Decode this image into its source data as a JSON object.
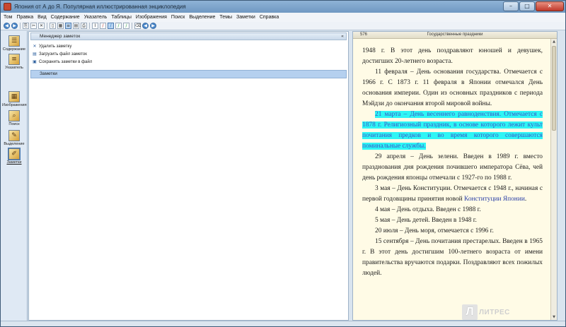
{
  "window": {
    "title": "Япония от А до Я. Популярная иллюстрированная энциклопедия",
    "minimize": "–",
    "maximize": "□",
    "close": "✕"
  },
  "menu": [
    "Том",
    "Правка",
    "Вид",
    "Содержание",
    "Указатель",
    "Таблицы",
    "Изображения",
    "Поиск",
    "Выделение",
    "Темы",
    "Заметки",
    "Справка"
  ],
  "toolbar": {
    "icons": [
      "back-icon",
      "forward-icon",
      "copy-icon",
      "cut-icon",
      "delete-icon",
      "page-icon",
      "grid-icon",
      "list-icon",
      "layout-icon",
      "print-icon",
      "cursor-icon",
      "pen-icon",
      "highlighter-icon",
      "marker-icon",
      "pencil-icon",
      "eraser-icon",
      "search-icon",
      "prev-icon",
      "next-icon"
    ]
  },
  "sidebar": {
    "items": [
      {
        "label": "Содержание",
        "icon": "book-icon",
        "glyph": "☰"
      },
      {
        "label": "Указатель",
        "icon": "index-icon",
        "glyph": "≡"
      },
      {
        "label": "Изображения",
        "icon": "images-icon",
        "glyph": "▦"
      },
      {
        "label": "Поиск",
        "icon": "search-icon",
        "glyph": "⌕"
      },
      {
        "label": "Выделение",
        "icon": "highlight-icon",
        "glyph": "✎"
      },
      {
        "label": "Заметки",
        "icon": "notes-icon",
        "glyph": "✐"
      }
    ]
  },
  "notes": {
    "manager_title": "Менеджер заметок",
    "collapse": "«",
    "actions": [
      {
        "label": "Удалить заметку",
        "icon": "delete-note-icon",
        "glyph": "✕"
      },
      {
        "label": "Загрузить файл заметок",
        "icon": "load-notes-icon",
        "glyph": "▤"
      },
      {
        "label": "Сохранить заметки в файл",
        "icon": "save-notes-icon",
        "glyph": "▣"
      }
    ],
    "section_title": "Заметки"
  },
  "reader": {
    "page_number": "576",
    "section_title": "Государственные праздники",
    "p1": "1948 г. В этот день поздравляют юношей и девушек, достигших 20-летнего возраста.",
    "p2": "11 февраля – День основания государства. Отмечается с 1966 г. С 1873 г. 11 февраля в Японии отмечался День основания империи. Один из основных праздников с периода Мэйдзи до окончания второй мировой войны.",
    "p3": "21 марта – День весеннего равноденствия. Отмечается с 1878 г. Религиозный праздник, в основе которого лежит культ почитания предков и во время которого совершаются поминальные службы.",
    "p4": "29 апреля – День зелени. Введен в 1989 г. вместо празднования дня рождения почившего императора Сёва, чей день рождения японцы отмечали с 1927-го по 1988 г.",
    "p5_text": "3 мая – День Конституции. Отмечается с 1948 г., начиная с первой годовщины принятия новой ",
    "p5_link": "Конституции Японии",
    "p5_end": ".",
    "p6": "4 мая – День отдыха. Введен с 1988 г.",
    "p7": "5 мая – День детей. Введен в 1948 г.",
    "p8": "20 июля – День моря, отмечается с 1996 г.",
    "p9": "15 сентября – День почитания престарелых. Введен в 1965 г. В этот день достигшим 100-летнего возраста от имени правительства вручаются подарки. Поздравляют всех пожилых людей."
  },
  "watermark": {
    "glyph": "Л",
    "text": "ЛИТРЕС"
  },
  "colors": {
    "highlight_bg": "#2ef5f5",
    "highlight_text": "#3b56c6",
    "link": "#2a3fa6",
    "page_bg": "#fffbe6"
  }
}
